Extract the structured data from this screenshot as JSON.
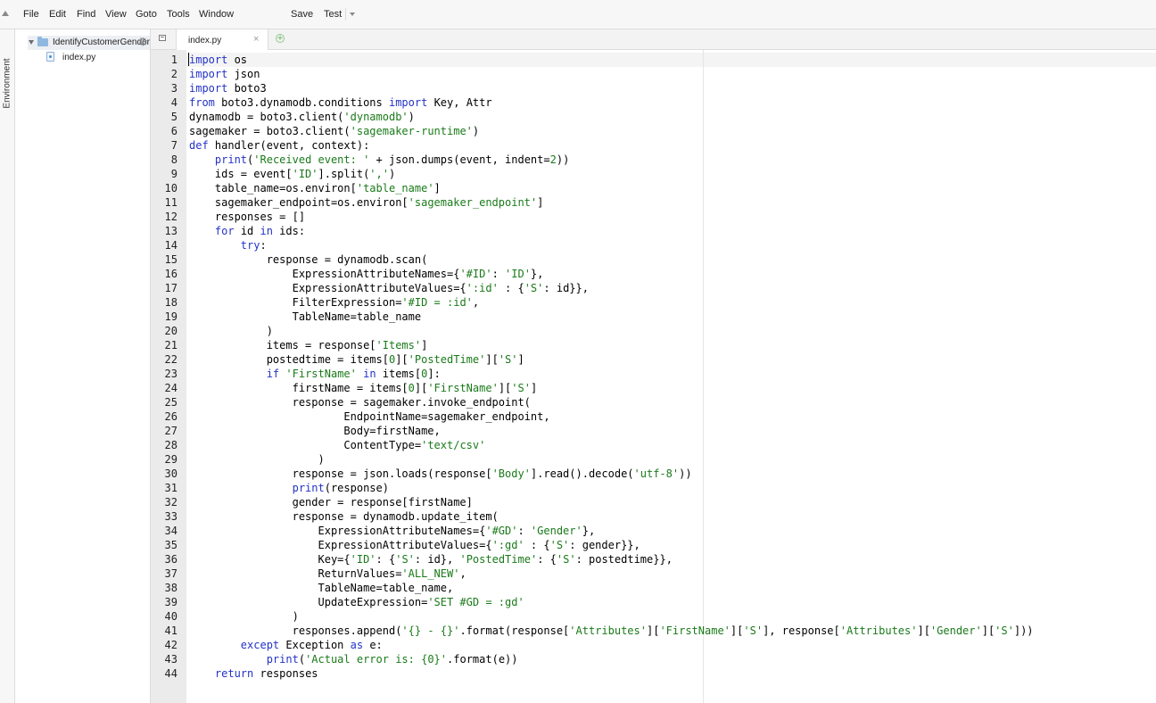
{
  "menu": {
    "items": [
      "File",
      "Edit",
      "Find",
      "View",
      "Goto",
      "Tools",
      "Window",
      "Save",
      "Test"
    ]
  },
  "sidepanel": {
    "label": "Environment"
  },
  "file_tree": {
    "root": "IdentifyCustomerGender",
    "files": [
      "index.py"
    ]
  },
  "tabs": [
    {
      "label": "index.py",
      "close": "×"
    }
  ],
  "new_tab": "+",
  "editor": {
    "language": "python",
    "lines": [
      "import os",
      "import json",
      "import boto3",
      "from boto3.dynamodb.conditions import Key, Attr",
      "dynamodb = boto3.client('dynamodb')",
      "sagemaker = boto3.client('sagemaker-runtime')",
      "def handler(event, context):",
      "    print('Received event: ' + json.dumps(event, indent=2))",
      "    ids = event['ID'].split(',')",
      "    table_name=os.environ['table_name']",
      "    sagemaker_endpoint=os.environ['sagemaker_endpoint']",
      "    responses = []",
      "    for id in ids:",
      "        try:",
      "            response = dynamodb.scan(",
      "                ExpressionAttributeNames={'#ID': 'ID'},",
      "                ExpressionAttributeValues={':id' : {'S': id}},",
      "                FilterExpression='#ID = :id',",
      "                TableName=table_name",
      "            )",
      "            items = response['Items']",
      "            postedtime = items[0]['PostedTime']['S']",
      "            if 'FirstName' in items[0]:",
      "                firstName = items[0]['FirstName']['S']",
      "                response = sagemaker.invoke_endpoint(",
      "                        EndpointName=sagemaker_endpoint,",
      "                        Body=firstName,",
      "                        ContentType='text/csv'",
      "                    )",
      "                response = json.loads(response['Body'].read().decode('utf-8'))",
      "                print(response)",
      "                gender = response[firstName]",
      "                response = dynamodb.update_item(",
      "                    ExpressionAttributeNames={'#GD': 'Gender'},",
      "                    ExpressionAttributeValues={':gd' : {'S': gender}},",
      "                    Key={'ID': {'S': id}, 'PostedTime': {'S': postedtime}},",
      "                    ReturnValues='ALL_NEW',",
      "                    TableName=table_name,",
      "                    UpdateExpression='SET #GD = :gd'",
      "                )",
      "                responses.append('{} - {}'.format(response['Attributes']['FirstName']['S'], response['Attributes']['Gender']['S']))",
      "        except Exception as e:",
      "            print('Actual error is: {0}'.format(e))",
      "    return responses"
    ]
  },
  "colors": {
    "keyword": "#2333c7",
    "string": "#1a7a1a",
    "gutter": "#ebebeb",
    "active_line": "#f4f4f4"
  }
}
